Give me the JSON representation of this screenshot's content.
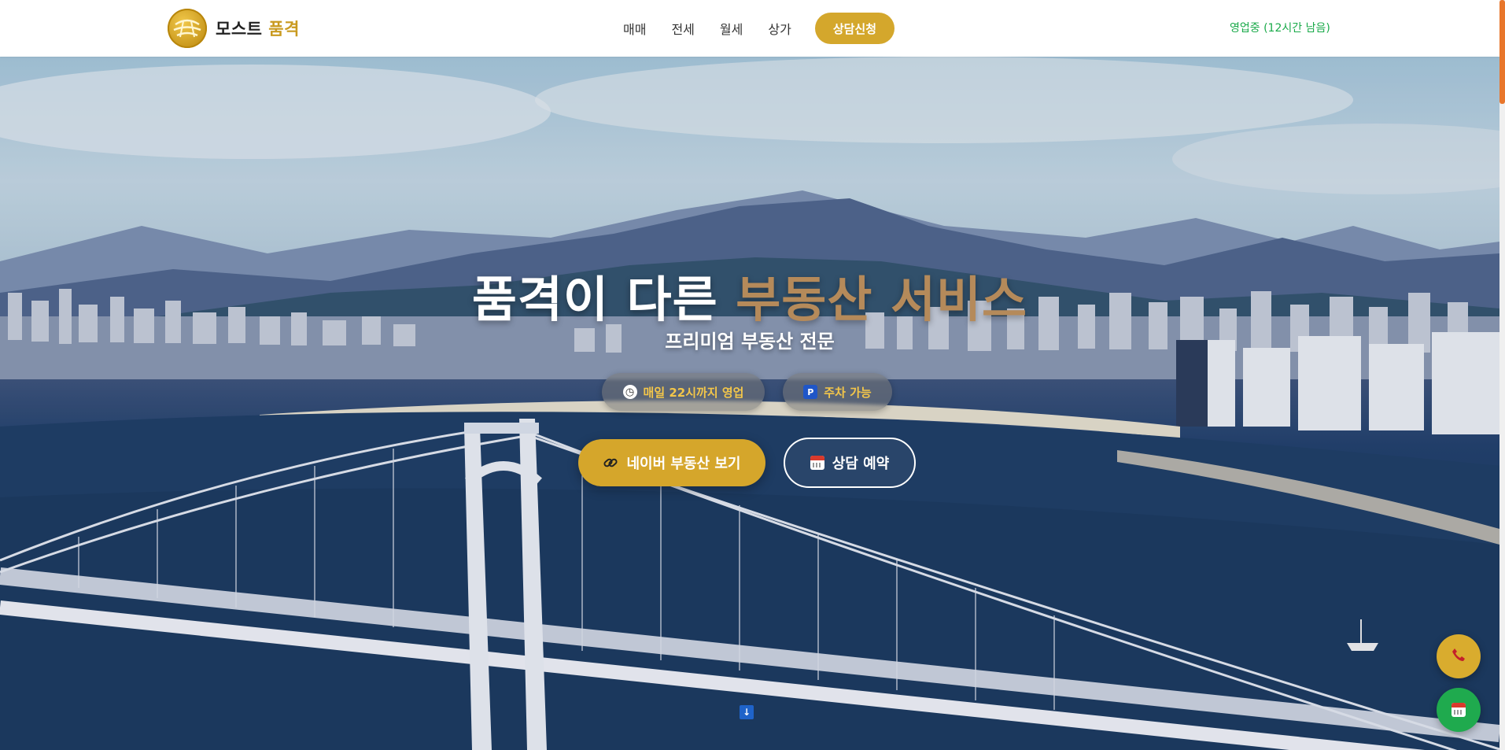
{
  "header": {
    "logo": {
      "name_main": "모스트 ",
      "name_accent": "품격"
    },
    "nav": [
      {
        "label": "매매"
      },
      {
        "label": "전세"
      },
      {
        "label": "월세"
      },
      {
        "label": "상가"
      }
    ],
    "cta_label": "상담신청",
    "status_text": "영업중 (12시간 남음)"
  },
  "hero": {
    "title_main": "품격이 다른 ",
    "title_accent": "부동산 서비스",
    "subtitle": "프리미엄 부동산 전문",
    "badges": [
      {
        "icon": "clock-icon",
        "label": "매일 22시까지 영업"
      },
      {
        "icon": "parking-icon",
        "label": "주차 가능",
        "icon_text": "P"
      }
    ],
    "buttons": {
      "naver_label": "네이버 부동산 보기",
      "consult_label": "상담 예약"
    },
    "scroll_icon": "↓"
  },
  "floating": {
    "call_icon": "phone-icon",
    "calendar_icon": "calendar-icon"
  },
  "colors": {
    "brand_gold": "#d4a72c",
    "status_green": "#1aaa4a",
    "accent_title": "#b58a5a",
    "float_green": "#1faa4e"
  }
}
